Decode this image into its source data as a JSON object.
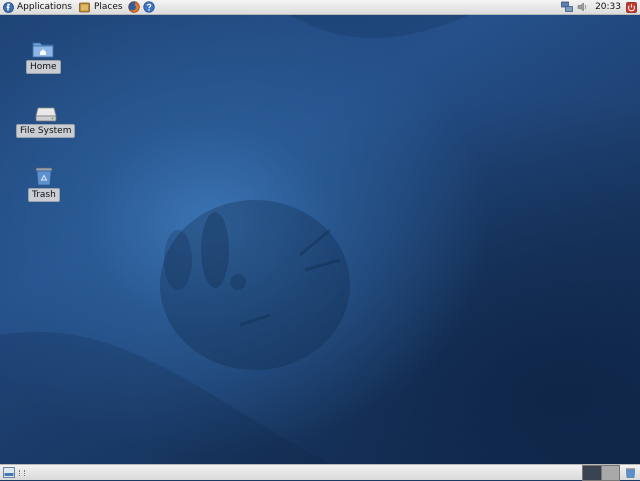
{
  "top_panel": {
    "applications_label": "Applications",
    "places_label": "Places",
    "clock": "20:33"
  },
  "desktop": {
    "icons": [
      {
        "label": "Home",
        "icon": "home-folder-icon"
      },
      {
        "label": "File System",
        "icon": "drive-icon"
      },
      {
        "label": "Trash",
        "icon": "trash-icon"
      }
    ]
  },
  "bottom_panel": {
    "workspaces": [
      {
        "active": true
      },
      {
        "active": false
      }
    ]
  },
  "colors": {
    "desktop_base": "#1b3a63",
    "desktop_glow": "#3c76b6",
    "panel": "#e6e6e6"
  }
}
